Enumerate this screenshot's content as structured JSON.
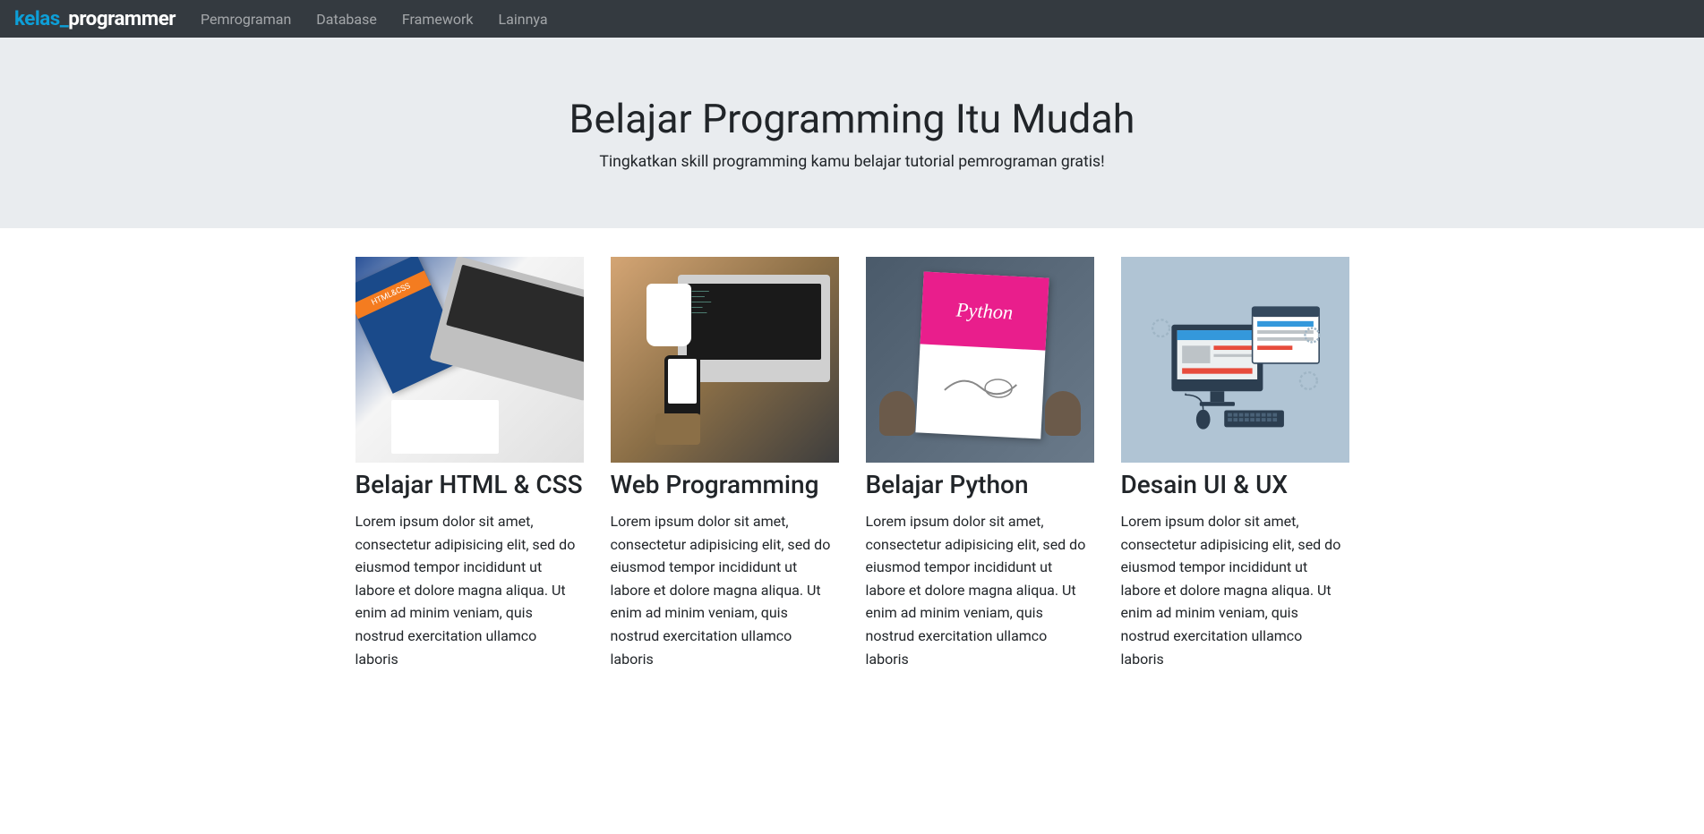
{
  "brand": {
    "part1": "kelas_",
    "part2": "programmer"
  },
  "nav": {
    "items": [
      {
        "label": "Pemrograman"
      },
      {
        "label": "Database"
      },
      {
        "label": "Framework"
      },
      {
        "label": "Lainnya"
      }
    ]
  },
  "hero": {
    "title": "Belajar Programming Itu Mudah",
    "subtitle": "Tingkatkan skill programming kamu belajar tutorial pemrograman gratis!"
  },
  "cards": [
    {
      "title": "Belajar HTML & CSS",
      "text": "Lorem ipsum dolor sit amet, consectetur adipisicing elit, sed do eiusmod tempor incididunt ut labore et dolore magna aliqua. Ut enim ad minim veniam, quis nostrud exercitation ullamco laboris",
      "imgLabel": "HTML&CSS"
    },
    {
      "title": "Web Programming",
      "text": "Lorem ipsum dolor sit amet, consectetur adipisicing elit, sed do eiusmod tempor incididunt ut labore et dolore magna aliqua. Ut enim ad minim veniam, quis nostrud exercitation ullamco laboris"
    },
    {
      "title": "Belajar Python",
      "text": "Lorem ipsum dolor sit amet, consectetur adipisicing elit, sed do eiusmod tempor incididunt ut labore et dolore magna aliqua. Ut enim ad minim veniam, quis nostrud exercitation ullamco laboris",
      "imgLabel": "Python"
    },
    {
      "title": "Desain UI & UX",
      "text": "Lorem ipsum dolor sit amet, consectetur adipisicing elit, sed do eiusmod tempor incididunt ut labore et dolore magna aliqua. Ut enim ad minim veniam, quis nostrud exercitation ullamco laboris"
    }
  ]
}
